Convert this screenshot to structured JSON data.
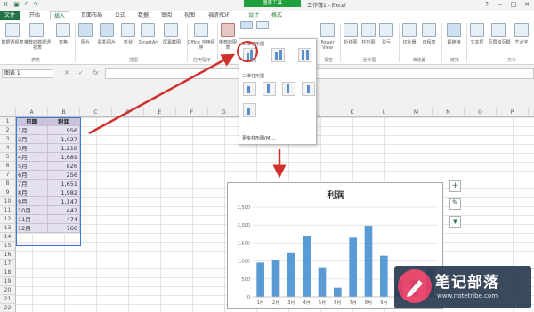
{
  "app": {
    "window_title": "工作簿1 - Excel",
    "context_group": "图表工具"
  },
  "tabs": [
    {
      "label": "文件"
    },
    {
      "label": "开始"
    },
    {
      "label": "插入"
    },
    {
      "label": "页面布局"
    },
    {
      "label": "公式"
    },
    {
      "label": "数据"
    },
    {
      "label": "审阅"
    },
    {
      "label": "视图"
    },
    {
      "label": "福昕PDF"
    },
    {
      "label": "设计"
    },
    {
      "label": "格式"
    }
  ],
  "ribbon": {
    "buttons": [
      {
        "label": "数据透视表"
      },
      {
        "label": "推荐的数据透视表"
      },
      {
        "label": "表格"
      },
      {
        "label": "图片"
      },
      {
        "label": "联机图片"
      },
      {
        "label": "形状"
      },
      {
        "label": "SmartArt"
      },
      {
        "label": "屏幕截图"
      },
      {
        "label": "Office 应用程序"
      },
      {
        "label": "推荐的图表"
      },
      {
        "label": "Power View"
      },
      {
        "label": "折线图"
      },
      {
        "label": "柱形图"
      },
      {
        "label": "盈亏"
      },
      {
        "label": "切片器"
      },
      {
        "label": "日程表"
      },
      {
        "label": "超链接"
      },
      {
        "label": "文本框"
      },
      {
        "label": "页眉和页脚"
      },
      {
        "label": "艺术字"
      }
    ],
    "groups": [
      {
        "label": "表格"
      },
      {
        "label": "插图"
      },
      {
        "label": "应用程序"
      },
      {
        "label": "报告"
      },
      {
        "label": "迷你图"
      },
      {
        "label": "筛选器"
      },
      {
        "label": "链接"
      },
      {
        "label": "文本"
      }
    ]
  },
  "formula_bar": {
    "name_box": "图表 1",
    "fx": "fx",
    "value": ""
  },
  "columns": [
    "A",
    "B",
    "C",
    "D",
    "E",
    "F",
    "G",
    "H",
    "I",
    "J",
    "K",
    "L",
    "M",
    "N",
    "O",
    "P",
    "Q"
  ],
  "rows": [
    "1",
    "2",
    "3",
    "4",
    "5",
    "6",
    "7",
    "8",
    "9",
    "10",
    "11",
    "12",
    "13",
    "14",
    "15",
    "16",
    "17",
    "18",
    "19",
    "20",
    "21",
    "22"
  ],
  "table": {
    "headers": [
      "日期",
      "利润"
    ],
    "rows": [
      [
        "1月",
        "956"
      ],
      [
        "2月",
        "1,027"
      ],
      [
        "3月",
        "1,218"
      ],
      [
        "4月",
        "1,689"
      ],
      [
        "5月",
        "826"
      ],
      [
        "6月",
        "256"
      ],
      [
        "7月",
        "1,651"
      ],
      [
        "8月",
        "1,982"
      ],
      [
        "9月",
        "1,147"
      ],
      [
        "10月",
        "442"
      ],
      [
        "11月",
        "474"
      ],
      [
        "12月",
        "760"
      ]
    ]
  },
  "dropdown": {
    "section_2d": "二维柱形图",
    "section_3d": "三维柱形图",
    "more": "更多柱形图(M)..."
  },
  "chart_data": {
    "type": "bar",
    "title": "利润",
    "categories": [
      "1月",
      "2月",
      "3月",
      "4月",
      "5月",
      "6月",
      "7月",
      "8月",
      "9月",
      "10月",
      "11月",
      "12月"
    ],
    "values": [
      956,
      1027,
      1218,
      1689,
      826,
      256,
      1651,
      1982,
      1147,
      442,
      474,
      760
    ],
    "visible_categories": [
      "1月",
      "2月",
      "3月",
      "4月",
      "5月",
      "6月",
      "7月",
      "8月",
      "9月"
    ],
    "ylim": [
      0,
      2500
    ],
    "yticks": [
      "0",
      "500",
      "1,000",
      "1,500",
      "2,000",
      "2,500"
    ],
    "grid": true,
    "bar_color": "#5b9bd5"
  },
  "chart_side_buttons": [
    "+",
    "✎",
    "▼"
  ],
  "watermark": {
    "text": "笔记部落",
    "url": "www.notetribe.com"
  },
  "colors": {
    "excel_green": "#217346",
    "context_green": "#1fa03c",
    "arrow_red": "#d0312d"
  }
}
